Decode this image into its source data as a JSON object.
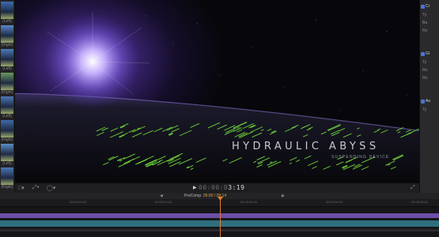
{
  "browser": {
    "clips": [
      {
        "label": "(Left)",
        "color": "#3d6db0"
      },
      {
        "label": "(Right)",
        "color": "#5a88c8"
      },
      {
        "label": "(Left)",
        "color": "#4a7ab8"
      },
      {
        "label": "(Right)",
        "color": "#6b9a60"
      },
      {
        "label": "(Left)",
        "color": "#4c78b4"
      },
      {
        "label": "(Right)",
        "color": "#3f6aa8"
      },
      {
        "label": "(Left)",
        "color": "#5c8cc4"
      },
      {
        "label": "(Right)",
        "color": "#4a78b8"
      }
    ]
  },
  "viewer": {
    "title_text": "HYDRAULIC ABYSS",
    "subtitle_text": "SUSPENDING DEVICE",
    "glitch_color": "#6cd43a"
  },
  "inspector": {
    "sections": [
      {
        "head": "Cr",
        "rows": [
          "Ty",
          "Ba",
          "Ro"
        ]
      },
      {
        "head": "Gl",
        "rows": [
          "Ty",
          "Ro",
          "Ro"
        ]
      },
      {
        "head": "Au",
        "rows": [
          "Ty"
        ]
      }
    ]
  },
  "viewer_toolbar": {
    "timecode_dim": "00:00:0",
    "timecode_lit": "3:19",
    "play_icon": "play-icon"
  },
  "timeline": {
    "project_name": "PreComp",
    "time_display": "09:00 / 09:14",
    "ruler_ticks": [
      "00:00:00:00",
      "00:00:02:00",
      "00:00:04:00",
      "00:00:06:00",
      "00:00:08:00"
    ]
  }
}
